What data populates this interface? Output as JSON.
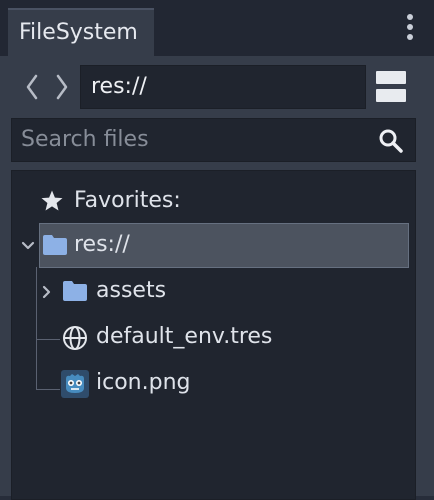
{
  "dock": {
    "tab_label": "FileSystem",
    "menu_icon": "kebab-menu-icon"
  },
  "navigation": {
    "back_icon": "chevron-left-icon",
    "forward_icon": "chevron-right-icon",
    "path_value": "res://",
    "split_icon": "split-view-icon"
  },
  "search": {
    "placeholder": "Search files",
    "icon": "magnifier-icon"
  },
  "tree": {
    "favorites_label": "Favorites:",
    "items": [
      {
        "label": "res://",
        "icon": "folder-icon",
        "selected": true,
        "expanded": true
      },
      {
        "label": "assets",
        "icon": "folder-icon",
        "selected": false,
        "expanded": false
      },
      {
        "label": "default_env.tres",
        "icon": "globe-icon",
        "selected": false
      },
      {
        "label": "icon.png",
        "icon": "godot-icon",
        "selected": false
      }
    ]
  },
  "colors": {
    "folder": "#8db1e6",
    "selection": "#4c535f",
    "panel": "#363d4a",
    "field": "#20252f"
  }
}
